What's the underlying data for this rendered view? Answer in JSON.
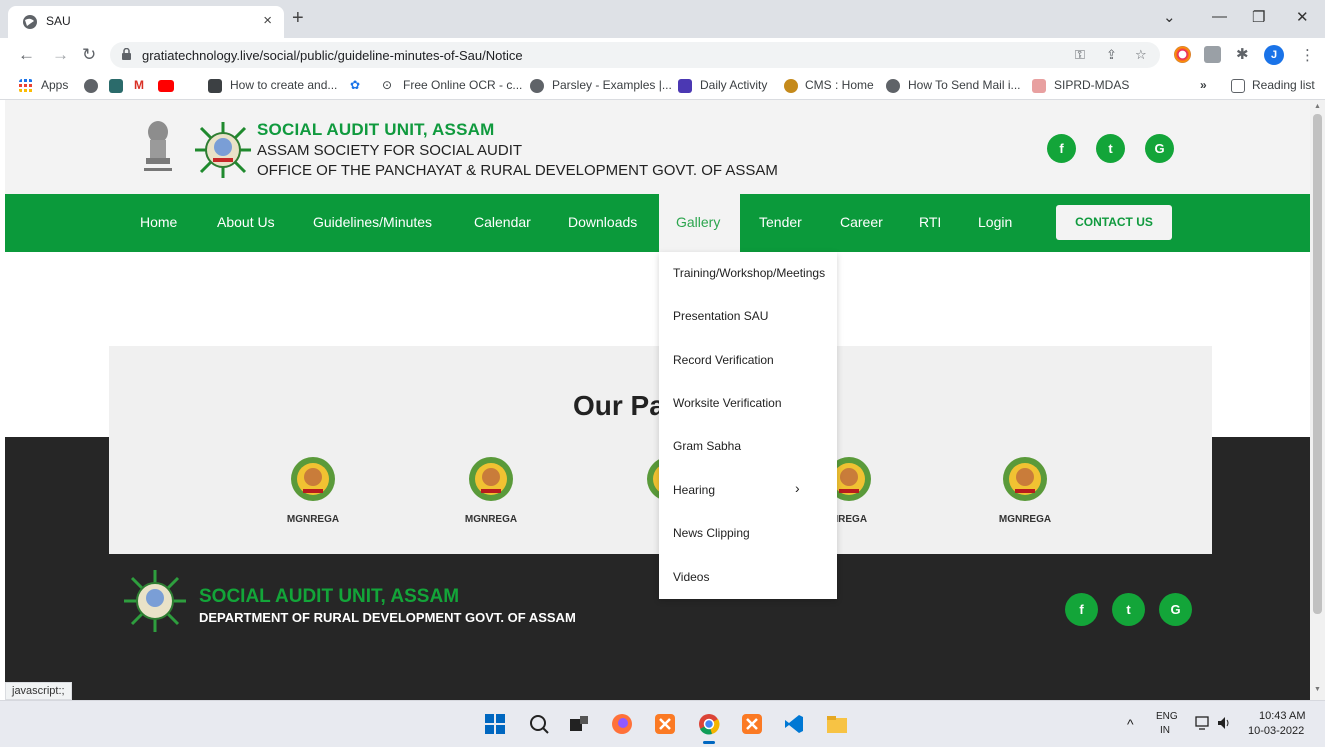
{
  "browser": {
    "tab_title": "SAU",
    "tab_close": "×",
    "new_tab": "+",
    "window_controls": [
      "⌄",
      "—",
      "❐",
      "✕"
    ],
    "url": "gratiatechnology.live/social/public/guideline-minutes-of-Sau/Notice",
    "profile_initial": "J",
    "bookmarks": [
      {
        "label": "Apps",
        "icon": "apps-grid-icon"
      },
      {
        "label": "How to create and...",
        "icon": "ocr-icon"
      },
      {
        "label": "Free Online OCR - c...",
        "icon": "ocr-icon"
      },
      {
        "label": "Parsley - Examples |...",
        "icon": "globe-icon"
      },
      {
        "label": "Daily Activity",
        "icon": "list-icon"
      },
      {
        "label": "CMS : Home",
        "icon": "cms-icon"
      },
      {
        "label": "How To Send Mail i...",
        "icon": "globe-icon"
      },
      {
        "label": "SIPRD-MDAS",
        "icon": "siprd-icon"
      }
    ],
    "overflow": "»",
    "reading_list": "Reading list",
    "status_text": "javascript:;"
  },
  "site": {
    "org_name": "SOCIAL AUDIT UNIT, ASSAM",
    "org_line2": "ASSAM SOCIETY FOR SOCIAL AUDIT",
    "org_line3": "OFFICE OF THE PANCHAYAT & RURAL DEVELOPMENT GOVT. OF ASSAM",
    "social": [
      "f",
      "t",
      "G"
    ],
    "nav": [
      "Home",
      "About Us",
      "Guidelines/Minutes",
      "Calendar",
      "Downloads",
      "Gallery",
      "Tender",
      "Career",
      "RTI",
      "Login"
    ],
    "contact_label": "CONTACT US",
    "gallery_menu": [
      "Training/Workshop/Meetings",
      "Presentation SAU",
      "Record Verification",
      "Worksite Verification",
      "Gram Sabha",
      "Hearing",
      "News Clipping",
      "Videos"
    ],
    "hearing_chevron": "›",
    "partners_title": "Our Pa",
    "partner_labels": [
      "MGNREGA",
      "MGNREGA",
      "MG",
      "NREGA",
      "MGNREGA"
    ],
    "footer_title": "SOCIAL AUDIT UNIT, ASSAM",
    "footer_subtitle": "DEPARTMENT OF RURAL DEVELOPMENT GOVT. OF ASSAM",
    "footer_social": [
      "f",
      "t",
      "G"
    ]
  },
  "taskbar": {
    "lang1": "ENG",
    "lang2": "IN",
    "time": "10:43 AM",
    "date": "10-03-2022",
    "tray_chevron": "^"
  },
  "colors": {
    "brand_green": "#0b9a3b",
    "logo_green": "#13a539",
    "footer_bg": "#262626"
  }
}
